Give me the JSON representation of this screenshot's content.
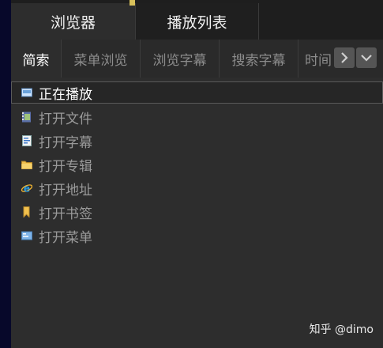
{
  "top_tabs": {
    "browser": "浏览器",
    "playlist": "播放列表"
  },
  "sub_tabs": [
    "简索",
    "菜单浏览",
    "浏览字幕",
    "搜索字幕",
    "时间"
  ],
  "list": [
    {
      "label": "正在播放",
      "icon": "now-playing-icon"
    },
    {
      "label": "打开文件",
      "icon": "film-file-icon"
    },
    {
      "label": "打开字幕",
      "icon": "subtitle-doc-icon"
    },
    {
      "label": "打开专辑",
      "icon": "folder-icon"
    },
    {
      "label": "打开地址",
      "icon": "ie-browser-icon"
    },
    {
      "label": "打开书签",
      "icon": "bookmark-icon"
    },
    {
      "label": "打开菜单",
      "icon": "menu-icon"
    }
  ],
  "watermark": "知乎 @dimo",
  "colors": {
    "panel_bg": "#2d2d2d",
    "desktop_bg": "#0b0b2e",
    "active_text": "#ffffff",
    "inactive_text": "#8c8c8c"
  }
}
